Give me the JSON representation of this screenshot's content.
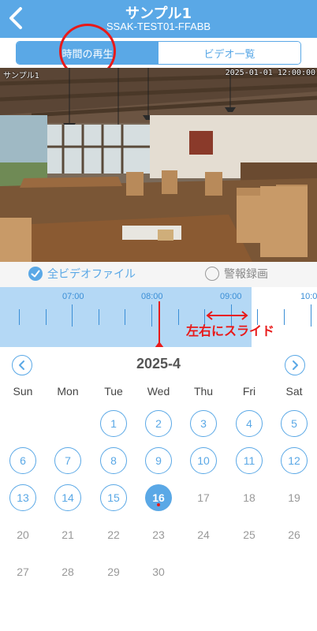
{
  "header": {
    "title": "サンプル1",
    "subtitle": "SSAK-TEST01-FFABB",
    "background": "#5aa8e6"
  },
  "tabs": [
    {
      "label": "時間の再生",
      "active": true
    },
    {
      "label": "ビデオ一覧",
      "active": false
    }
  ],
  "video": {
    "osd_name": "サンプル1",
    "osd_datetime": "2025-01-01 12:00:00"
  },
  "filters": {
    "all_label": "全ビデオファイル",
    "all_selected": true,
    "alarm_label": "警報録画",
    "alarm_selected": false
  },
  "timeline": {
    "labels": [
      "07:00",
      "08:00",
      "09:00",
      "10:0"
    ],
    "current_time": "08:05",
    "annotation": "左右にスライド"
  },
  "calendar": {
    "month_label": "2025-4",
    "weekdays": [
      "Sun",
      "Mon",
      "Tue",
      "Wed",
      "Thu",
      "Fri",
      "Sat"
    ],
    "selected_day": 16,
    "recorded_days": [
      1,
      2,
      3,
      4,
      5,
      6,
      7,
      8,
      9,
      10,
      11,
      12,
      13,
      14,
      15
    ],
    "rows": [
      [
        "",
        "",
        "1",
        "2",
        "3",
        "4",
        "5"
      ],
      [
        "6",
        "7",
        "8",
        "9",
        "10",
        "11",
        "12"
      ],
      [
        "13",
        "14",
        "15",
        "16",
        "17",
        "18",
        "19"
      ],
      [
        "20",
        "21",
        "22",
        "23",
        "24",
        "25",
        "26"
      ],
      [
        "27",
        "28",
        "29",
        "30",
        "",
        "",
        ""
      ]
    ]
  },
  "icons": {
    "back": "chevron-left-icon",
    "prev_month": "chevron-left-icon",
    "next_month": "chevron-right-icon",
    "check": "check-icon"
  },
  "colors": {
    "accent": "#5aa8e6",
    "recorded_band": "#b4d8f5",
    "annotation": "#e81a1a"
  }
}
